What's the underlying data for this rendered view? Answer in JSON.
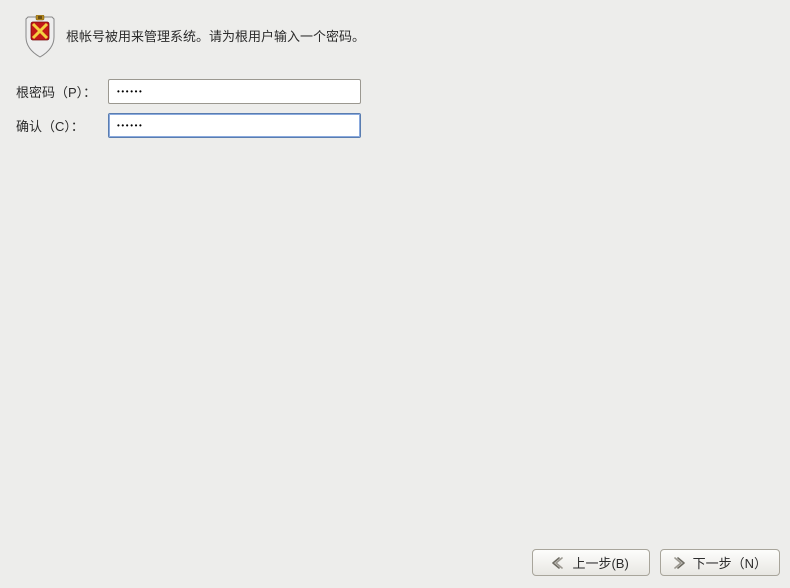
{
  "header": {
    "description": "根帐号被用来管理系统。请为根用户输入一个密码。"
  },
  "form": {
    "password_label": "根密码（P）：",
    "password_value": "••••••",
    "confirm_label": "确认（C）：",
    "confirm_value": "••••••"
  },
  "footer": {
    "back_label": "上一步(B)",
    "next_label": "下一步（N）"
  },
  "icons": {
    "shield": "shield-icon",
    "arrow_left": "arrow-left-icon",
    "arrow_right": "arrow-right-icon"
  }
}
